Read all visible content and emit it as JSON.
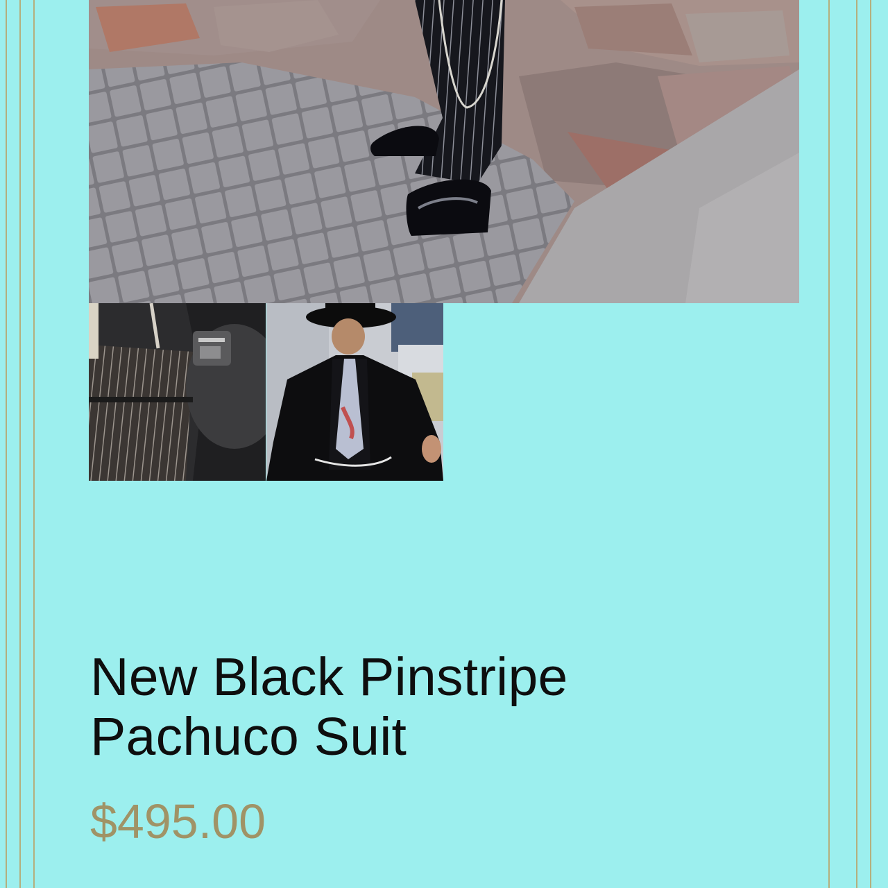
{
  "product": {
    "title": "New Black Pinstripe Pachuco Suit",
    "price": "$495.00"
  },
  "gallery": {
    "main_image": "pinstripe-pants-and-shoes-photo",
    "thumbnails": [
      "pinstripe-belt-detail-photo",
      "full-suit-model-photo"
    ]
  },
  "colors": {
    "background": "#9cefee",
    "border": "#b8a36a",
    "title": "#0e0e0e",
    "price": "#a09366"
  }
}
